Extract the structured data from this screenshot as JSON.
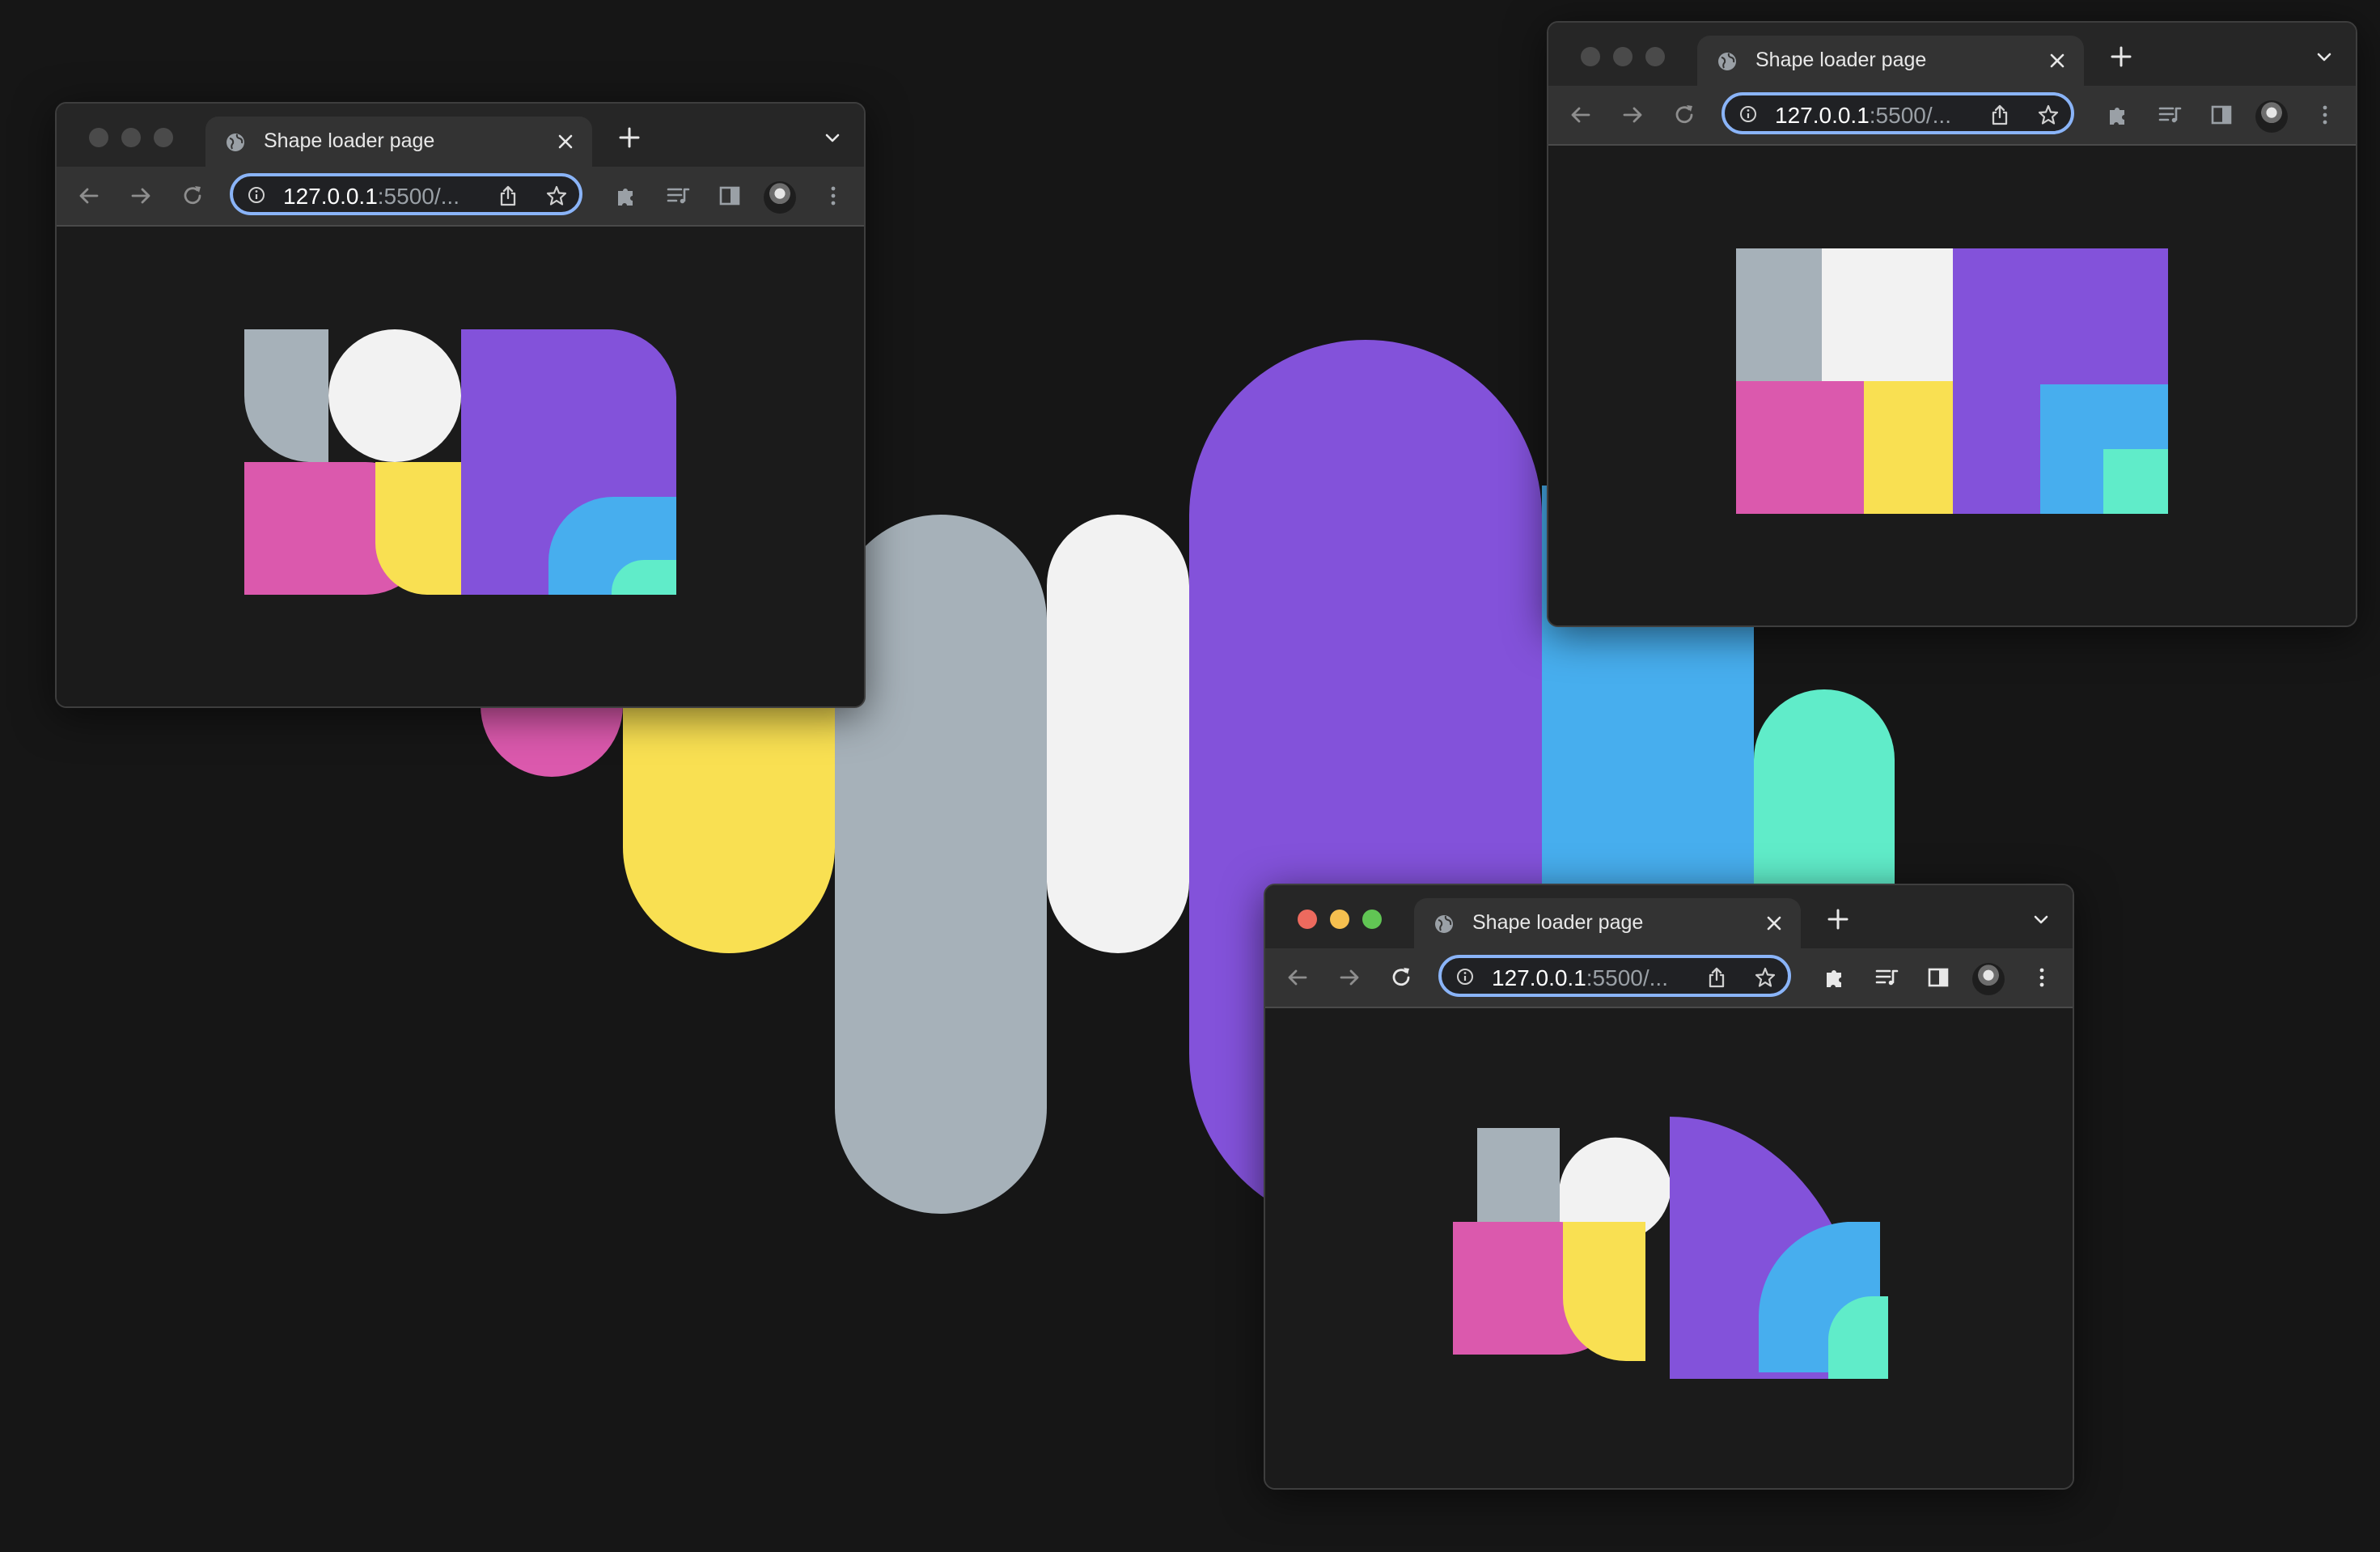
{
  "colors": {
    "background": "#161616",
    "gray": "#a6b1b9",
    "white": "#f2f2f2",
    "purple": "#8352da",
    "blue": "#47aeee",
    "teal": "#60ecc9",
    "pink": "#db59ad",
    "yellow": "#f9e052",
    "omnibox_outline": "#8ab4f8"
  },
  "windows": [
    {
      "id": "window-1",
      "state": "inactive",
      "tab": {
        "title": "Shape loader page",
        "icon": "globe-icon"
      },
      "address": {
        "host": "127.0.0.1",
        "path": ":5500/..."
      },
      "content": "rounded-shapes-grid"
    },
    {
      "id": "window-2",
      "state": "inactive",
      "tab": {
        "title": "Shape loader page",
        "icon": "globe-icon"
      },
      "address": {
        "host": "127.0.0.1",
        "path": ":5500/..."
      },
      "content": "square-shapes-grid"
    },
    {
      "id": "window-3",
      "state": "active",
      "tab": {
        "title": "Shape loader page",
        "icon": "globe-icon"
      },
      "address": {
        "host": "127.0.0.1",
        "path": ":5500/..."
      },
      "content": "animating-shapes-grid"
    }
  ],
  "toolbar_icons": [
    "back-arrow-icon",
    "forward-arrow-icon",
    "reload-icon",
    "info-icon",
    "share-icon",
    "bookmark-star-icon",
    "extensions-puzzle-icon",
    "reading-list-icon",
    "side-panel-icon",
    "profile-avatar",
    "more-menu-icon"
  ]
}
